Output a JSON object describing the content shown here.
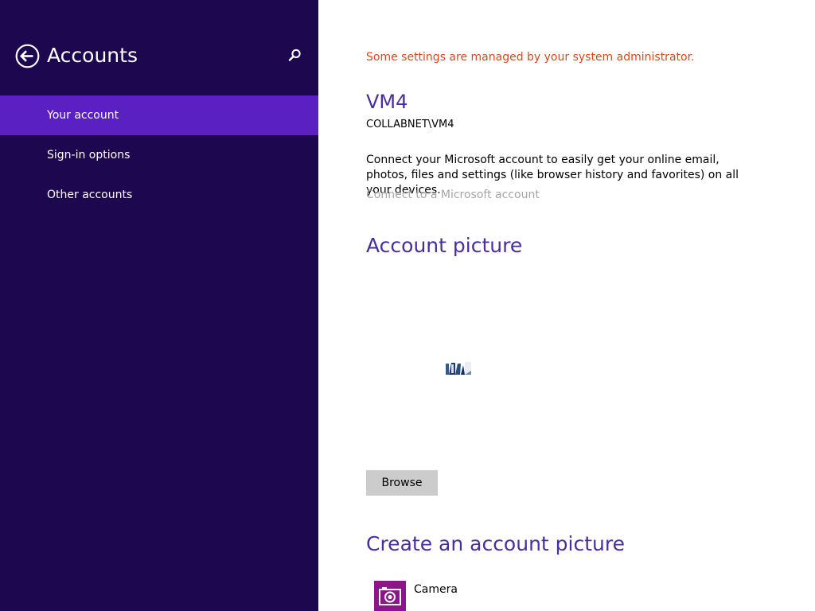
{
  "nav": {
    "title": "Accounts",
    "back_icon": "back-arrow-icon",
    "search_icon": "search-icon",
    "items": [
      {
        "label": "Your account",
        "selected": true
      },
      {
        "label": "Sign-in options",
        "selected": false
      },
      {
        "label": "Other accounts",
        "selected": false
      }
    ]
  },
  "content": {
    "admin_notice": "Some settings are managed by your system administrator.",
    "user_name": "VM4",
    "user_domain": "COLLABNET\\VM4",
    "connect_description": "Connect your Microsoft account to easily get your online email, photos, files and settings (like browser history and favorites) on all your devices.",
    "connect_link": "Connect to a Microsoft account",
    "account_picture_heading": "Account picture",
    "browse_label": "Browse",
    "create_heading": "Create an account picture",
    "apps": [
      {
        "label": "Camera",
        "icon": "camera-icon"
      }
    ]
  },
  "colors": {
    "nav_background": "#1d0850",
    "nav_selected": "#5a20c2",
    "heading": "#4a2ea0",
    "admin_notice": "#d8491d",
    "link_disabled": "#a6a6a6",
    "camera_tile": "#8a168a"
  }
}
